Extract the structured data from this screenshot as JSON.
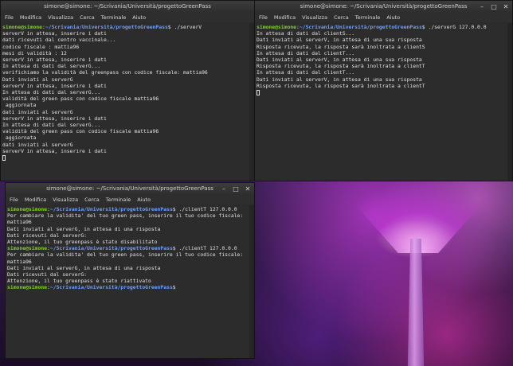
{
  "window1": {
    "title": "simone@simone: ~/Scrivania/Università/progettoGreenPass",
    "menu": [
      "File",
      "Modifica",
      "Visualizza",
      "Cerca",
      "Terminale",
      "Aiuto"
    ],
    "lines": [
      {
        "user": "simone@simone",
        "path": "~/Scrivania/Università/progettoGreenPass",
        "cmd": "$ ./serverV"
      },
      {
        "text": "serverV in attesa, inserire i dati"
      },
      {
        "text": "dati ricevuti dal centro vaccinale..."
      },
      {
        "text": ""
      },
      {
        "text": "codice fiscale : mattia96"
      },
      {
        "text": "mesi di validità : 12"
      },
      {
        "text": "serverV in attesa, inserire i dati"
      },
      {
        "text": "In attesa di dati dal serverG..."
      },
      {
        "text": "verifichiamo la validità del greenpass con codice fiscale: mattia96"
      },
      {
        "text": "Dati inviati al serverG"
      },
      {
        "text": "serverV in attesa, inserire i dati"
      },
      {
        "text": "In attesa di dati dal serverG..."
      },
      {
        "text": "validità del green pass con codice fiscale mattia96"
      },
      {
        "text": " aggiornata"
      },
      {
        "text": "dati inviati al serverG"
      },
      {
        "text": "serverV in attesa, inserire i dati"
      },
      {
        "text": "In attesa di dati dal serverG..."
      },
      {
        "text": "validità del green pass con codice fiscale mattia96"
      },
      {
        "text": " aggiornata"
      },
      {
        "text": "dati inviati al serverG"
      },
      {
        "text": "serverV in attesa, inserire i dati"
      }
    ]
  },
  "window2": {
    "title": "simone@simone: ~/Scrivania/Università/progettoGreenPass",
    "menu": [
      "File",
      "Modifica",
      "Visualizza",
      "Cerca",
      "Terminale",
      "Aiuto"
    ],
    "lines": [
      {
        "user": "simone@simone",
        "path": "~/Scrivania/Università/progettoGreenPass",
        "cmd": "$ ./serverG 127.0.0.0"
      },
      {
        "text": "In attesa di dati dal clientS..."
      },
      {
        "text": "Dati inviati al serverV, in attesa di una sua risposta"
      },
      {
        "text": "Risposta ricevuta, la risposta sarà inoltrata a clientS"
      },
      {
        "text": "In attesa di dati dal clientT..."
      },
      {
        "text": "Dati inviati al serverV, in attesa di una sua risposta"
      },
      {
        "text": "Risposta ricevuta, la risposta sarà inoltrata a clientT"
      },
      {
        "text": "In attesa di dati dal clientT..."
      },
      {
        "text": "Dati inviati al serverV, in attesa di una sua risposta"
      },
      {
        "text": "Risposta ricevuta, la risposta sarà inoltrata a clientT"
      }
    ]
  },
  "window3": {
    "title": "simone@simone: ~/Scrivania/Università/progettoGreenPass",
    "menu": [
      "File",
      "Modifica",
      "Visualizza",
      "Cerca",
      "Terminale",
      "Aiuto"
    ],
    "lines": [
      {
        "user": "simone@simone",
        "path": "~/Scrivania/Università/progettoGreenPass",
        "cmd": "$ ./clientT 127.0.0.0"
      },
      {
        "text": "Per cambiare la validita' del tuo green pass, inserire il tuo codice fiscale:"
      },
      {
        "text": "mattia96"
      },
      {
        "text": "Dati inviati al serverG, in attesa di una risposta"
      },
      {
        "text": "Dati ricevuti dal serverG:"
      },
      {
        "text": "Attenzione, il tuo greenpass è stato disabilitato"
      },
      {
        "user": "simone@simone",
        "path": "~/Scrivania/Università/progettoGreenPass",
        "cmd": "$ ./clientT 127.0.0.0"
      },
      {
        "text": "Per cambiare la validita' del tuo green pass, inserire il tuo codice fiscale:"
      },
      {
        "text": "mattia96"
      },
      {
        "text": "Dati inviati al serverG, in attesa di una risposta"
      },
      {
        "text": "Dati ricevuti dal serverG:"
      },
      {
        "text": "Attenzione, il tuo greenpass è stato riattivato"
      },
      {
        "user": "simone@simone",
        "path": "~/Scrivania/Università/progettoGreenPass",
        "cmd": "$"
      }
    ]
  },
  "icons": {
    "minimize": "minimize-icon",
    "maximize": "maximize-icon",
    "close": "close-icon"
  }
}
